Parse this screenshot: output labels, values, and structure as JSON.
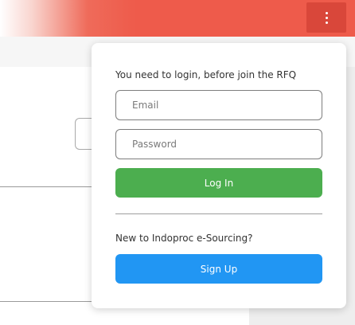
{
  "header": {
    "menu_icon": "more-vertical-icon",
    "bar_color": "#ee5b4b",
    "menu_button_color": "#d9473a"
  },
  "login_panel": {
    "prompt": "You need to login, before join the RFQ",
    "email_placeholder": "Email",
    "email_value": "",
    "password_placeholder": "Password",
    "password_value": "",
    "login_label": "Log In",
    "login_color": "#4cae4f",
    "signup_prompt": "New to Indoproc e-Sourcing?",
    "signup_label": "Sign Up",
    "signup_color": "#2196f3"
  }
}
